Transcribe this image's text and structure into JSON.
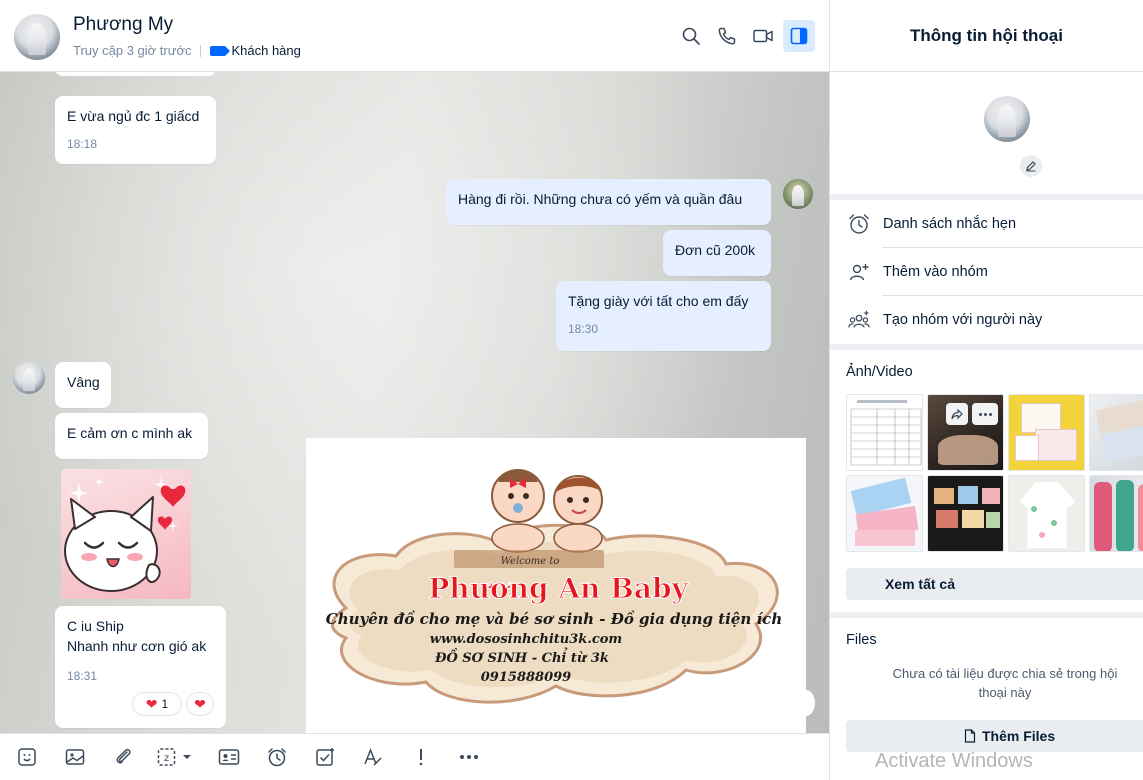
{
  "header": {
    "contact_name": "Phương My",
    "last_seen": "Truy cập 3 giờ trước",
    "tag_label": "Khách hàng",
    "icons": [
      "search-icon",
      "phone-icon",
      "video-call-icon",
      "panel-toggle-icon"
    ],
    "accent_color": "#0068ff"
  },
  "messages": [
    {
      "side": "them",
      "text": "E vừa ngủ đc 1 giấcd",
      "time": "18:18"
    },
    {
      "side": "me",
      "text": "Hàng đi rồi. Những chưa có yếm và quần đâu"
    },
    {
      "side": "me",
      "text": "Đơn cũ 200k"
    },
    {
      "side": "me",
      "text": "Tặng giày với tất cho em đấy",
      "time": "18:30"
    },
    {
      "side": "them",
      "text": "Vâng"
    },
    {
      "side": "them",
      "text": "E cảm ơn c mình ak"
    },
    {
      "side": "them",
      "type": "sticker"
    },
    {
      "side": "them",
      "text_line1": "C iu Ship",
      "text_line2": "Nhanh như cơn gió ak",
      "time": "18:31",
      "reaction_count": "1"
    }
  ],
  "banner": {
    "welcome": "Welcome to",
    "brand": "Phương An Baby",
    "slogan": "Chuyên đồ cho mẹ và bé sơ sinh - Đồ gia dụng tiện ích",
    "website": "www.dososinhchitu3k.com",
    "line2": "ĐỒ SƠ SINH - Chỉ từ 3k",
    "phone": "0915888099"
  },
  "toolbar": {
    "icons": [
      "sticker-icon",
      "image-icon",
      "attachment-icon",
      "screenshot-icon",
      "contact-card-icon",
      "reminder-icon",
      "task-icon",
      "format-text-icon",
      "urgent-icon",
      "more-icon"
    ]
  },
  "info_panel": {
    "title": "Thông tin hội thoại",
    "actions": [
      {
        "label": "Danh sách nhắc hẹn",
        "icon": "alarm-clock-icon"
      },
      {
        "label": "Thêm vào nhóm",
        "icon": "add-user-icon"
      },
      {
        "label": "Tạo nhóm với người này",
        "icon": "create-group-icon"
      }
    ],
    "media_title": "Ảnh/Video",
    "see_all": "Xem tất cả",
    "files_title": "Files",
    "files_empty": "Chưa có tài liệu được chia sẻ trong hội thoại này",
    "add_files": "Thêm Files"
  },
  "watermark": "Activate Windows"
}
